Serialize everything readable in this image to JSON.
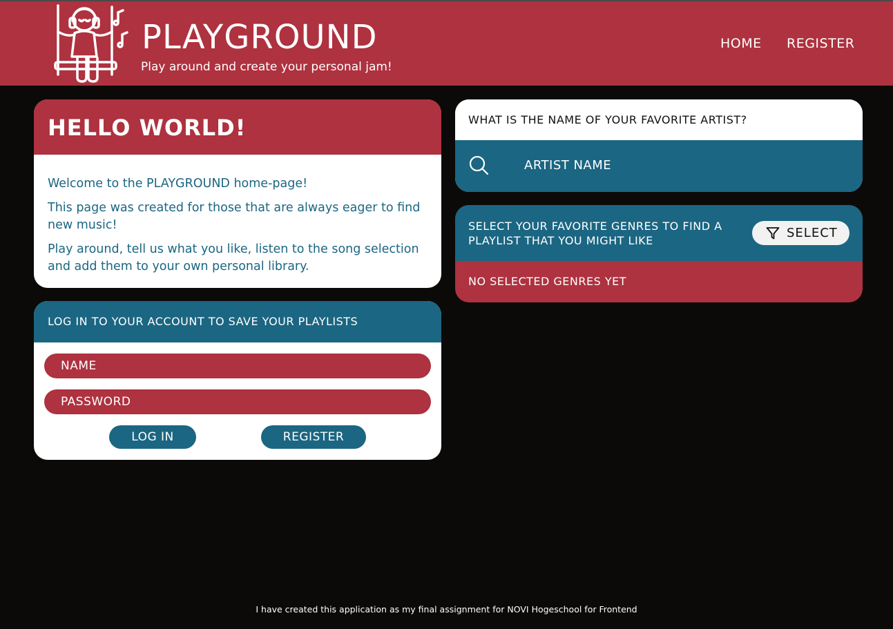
{
  "header": {
    "title": "PLAYGROUND",
    "subtitle": "Play around and create your personal jam!",
    "logo_icon": "swing-headphones-music-icon",
    "nav": {
      "home": "HOME",
      "register": "REGISTER"
    }
  },
  "hello": {
    "title": "HELLO WORLD!",
    "paragraphs": [
      "Welcome to the PLAYGROUND home-page!",
      "This page was created for those that are always eager to find new music!",
      "Play around, tell us what you like, listen to the song selection and add them to your own personal library."
    ]
  },
  "login": {
    "title": "LOG IN TO YOUR ACCOUNT TO SAVE YOUR PLAYLISTS",
    "name_placeholder": "NAME",
    "password_placeholder": "PASSWORD",
    "login_button": "LOG IN",
    "register_button": "REGISTER"
  },
  "artist": {
    "question": "WHAT IS THE NAME OF YOUR FAVORITE ARTIST?",
    "placeholder": "ARTIST NAME",
    "search_icon": "search-icon"
  },
  "genres": {
    "title": "SELECT YOUR FAVORITE GENRES TO FIND A PLAYLIST THAT YOU MIGHT LIKE",
    "select_button": "SELECT",
    "filter_icon": "filter-icon",
    "empty_text": "NO SELECTED GENRES YET"
  },
  "footer": {
    "text": "I have created this application as my final assignment for NOVI Hogeschool for Frontend"
  },
  "colors": {
    "red": "#ae323f",
    "blue": "#1b6682",
    "background": "#0b0a08",
    "white": "#ffffff"
  }
}
